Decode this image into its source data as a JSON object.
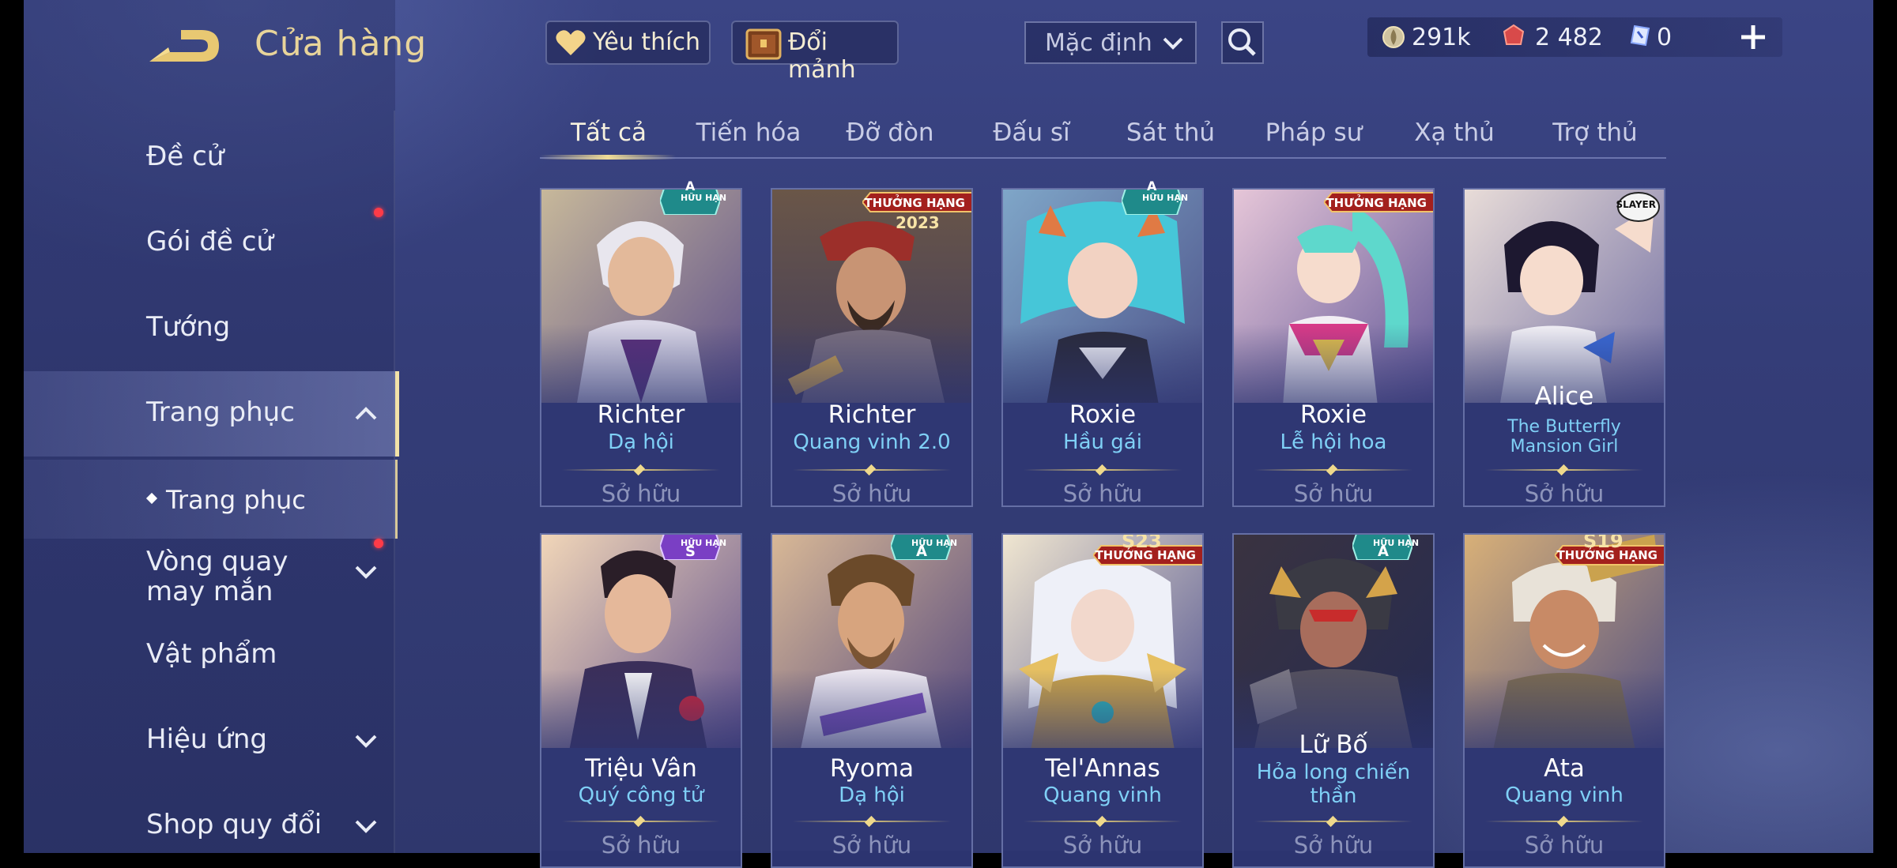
{
  "header": {
    "title": "Cửa hàng",
    "favorites_label": "Yêu thích",
    "exchange_label": "Đổi mảnh",
    "sort_value": "Mặc định"
  },
  "currencies": {
    "gold": "291k",
    "vouchers": "2 482",
    "tokens": "0"
  },
  "sidebar": {
    "items": [
      {
        "label": "Đề cử"
      },
      {
        "label": "Gói đề cử"
      },
      {
        "label": "Tướng"
      },
      {
        "label": "Trang phục"
      },
      {
        "label": "Trang phục"
      },
      {
        "label": "Vòng quay may mắn"
      },
      {
        "label": "Vật phẩm"
      },
      {
        "label": "Hiệu ứng"
      },
      {
        "label": "Shop quy đổi"
      }
    ]
  },
  "tabs": [
    "Tất cả",
    "Tiến hóa",
    "Đỡ đòn",
    "Đấu sĩ",
    "Sát thủ",
    "Pháp sư",
    "Xạ thủ",
    "Trợ thủ"
  ],
  "cards": [
    {
      "hero": "Richter",
      "skin": "Dạ hội",
      "status": "Sở hữu",
      "badge_grade": "A",
      "badge_note": "HỮU HẠN"
    },
    {
      "hero": "Richter",
      "skin": "Quang vinh 2.0",
      "status": "Sở hữu",
      "badge_rank": "THƯỞNG HẠNG",
      "badge_season": "2023"
    },
    {
      "hero": "Roxie",
      "skin": "Hầu gái",
      "status": "Sở hữu",
      "badge_grade": "A",
      "badge_note": "HỮU HẠN"
    },
    {
      "hero": "Roxie",
      "skin": "Lễ hội hoa",
      "status": "Sở hữu",
      "badge_rank": "THƯỞNG HẠNG"
    },
    {
      "hero": "Alice",
      "skin": "The Butterfly Mansion Girl",
      "status": "Sở hữu",
      "badge_collab": "SLAYER"
    },
    {
      "hero": "Triệu Vân",
      "skin": "Quý công tử",
      "status": "Sở hữu",
      "badge_grade": "S",
      "badge_note": "HỮU HẠN"
    },
    {
      "hero": "Ryoma",
      "skin": "Dạ hội",
      "status": "Sở hữu",
      "badge_grade": "A",
      "badge_note": "HỮU HẠN"
    },
    {
      "hero": "Tel'Annas",
      "skin": "Quang vinh",
      "status": "Sở hữu",
      "badge_rank": "THƯỞNG HẠNG",
      "badge_season": "S23"
    },
    {
      "hero": "Lữ Bố",
      "skin": "Hỏa long chiến thần",
      "status": "Sở hữu",
      "badge_grade": "A",
      "badge_note": "HỮU HẠN"
    },
    {
      "hero": "Ata",
      "skin": "Quang vinh",
      "status": "Sở hữu",
      "badge_rank": "THƯỞNG HẠNG",
      "badge_season": "S19"
    }
  ],
  "colors": {
    "accent_gold": "#e8d49a",
    "skin_blue": "#7fd0f6",
    "notification_red": "#ff3b48"
  }
}
